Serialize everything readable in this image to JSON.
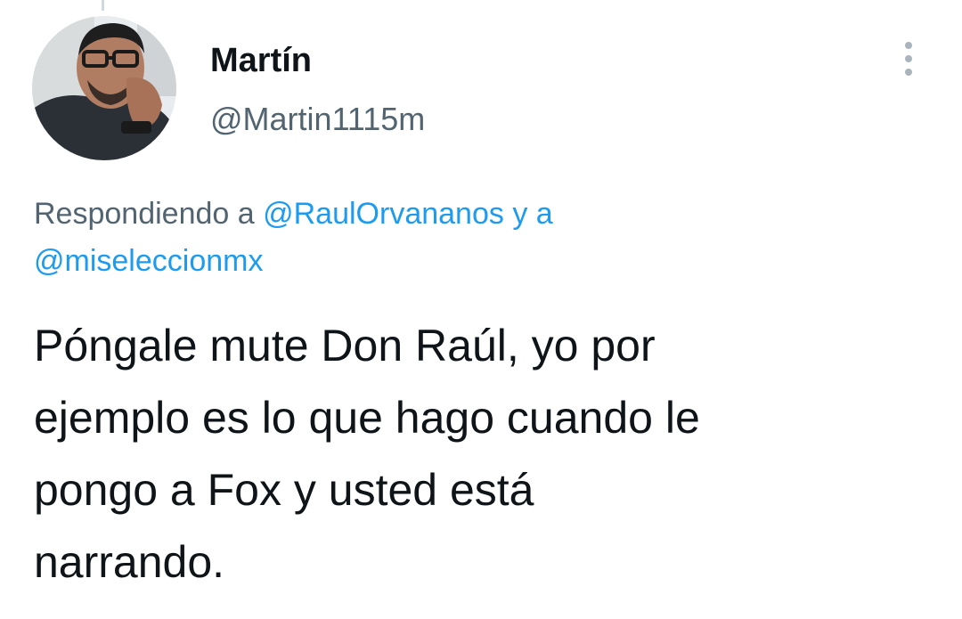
{
  "author": {
    "display_name": "Martín",
    "handle": "@Martin1115m",
    "avatar_icon": "user-avatar-photo"
  },
  "menu": {
    "icon": "more-vertical-icon"
  },
  "reply_context": {
    "prefix": "Respondiendo a",
    "mention_1": "@RaulOrvananos",
    "joiner": "y a",
    "mention_2": "@miseleccionmx"
  },
  "tweet": {
    "lines": [
      "Póngale mute Don Raúl, yo por",
      "ejemplo es lo que hago cuando le",
      "pongo a Fox y usted está",
      "narrando."
    ]
  },
  "colors": {
    "text_primary": "#0f1419",
    "text_secondary": "#536471",
    "link": "#1d9bf0",
    "background": "#ffffff"
  }
}
